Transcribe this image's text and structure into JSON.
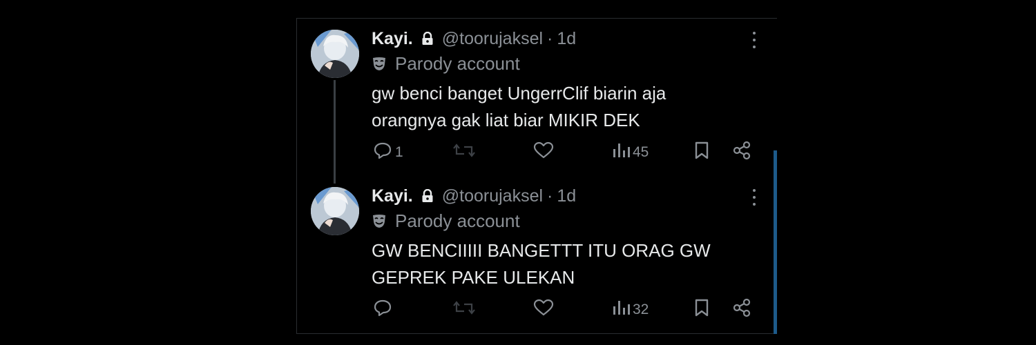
{
  "colors": {
    "background": "#000000",
    "text": "#e7e9ea",
    "muted": "#8b9096",
    "scroll_indicator": "#1d5a8a",
    "thread_line": "#3a3f44"
  },
  "tweets": [
    {
      "name": "Kayi.",
      "lock_icon": "lock-icon",
      "handle": "@toorujaksel",
      "separator": "·",
      "time": "1d",
      "label": "Parody account",
      "label_icon": "parody-mask-icon",
      "lines": [
        "gw benci banget UngerrClif biarin aja",
        "orangnya gak liat biar MIKIR DEK"
      ],
      "replies": "1",
      "reposts": "",
      "likes": "",
      "views": "45"
    },
    {
      "name": "Kayi.",
      "lock_icon": "lock-icon",
      "handle": "@toorujaksel",
      "separator": "·",
      "time": "1d",
      "label": "Parody account",
      "label_icon": "parody-mask-icon",
      "lines": [
        "GW BENCIIIII BANGETTT ITU ORAG GW",
        "GEPREK PAKE ULEKAN"
      ],
      "replies": "",
      "reposts": "",
      "likes": "",
      "views": "32"
    }
  ]
}
